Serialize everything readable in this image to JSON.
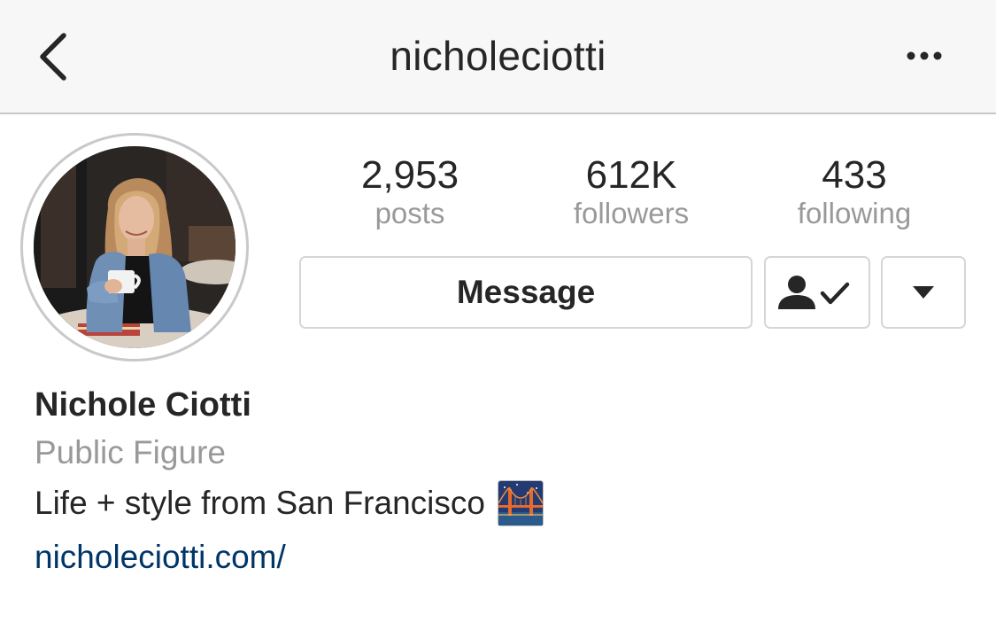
{
  "header": {
    "username": "nicholeciotti",
    "back_icon": "chevron-left-icon",
    "more_icon": "more-horizontal-icon"
  },
  "profile": {
    "avatar_alt": "profile photo"
  },
  "stats": {
    "posts": {
      "value": "2,953",
      "label": "posts"
    },
    "followers": {
      "value": "612K",
      "label": "followers"
    },
    "following": {
      "value": "433",
      "label": "following"
    }
  },
  "actions": {
    "message_label": "Message",
    "following_icon": "person-check-icon",
    "dropdown_icon": "caret-down-icon"
  },
  "bio": {
    "full_name": "Nichole Ciotti",
    "category": "Public Figure",
    "description": "Life + style from San Francisco",
    "emoji": "bridge-at-night-icon",
    "website": "nicholeciotti.com/"
  },
  "colors": {
    "text_primary": "#262626",
    "text_secondary": "#999999",
    "link": "#003569",
    "border": "#d6d6d6",
    "navbar_bg": "#f7f7f7"
  }
}
